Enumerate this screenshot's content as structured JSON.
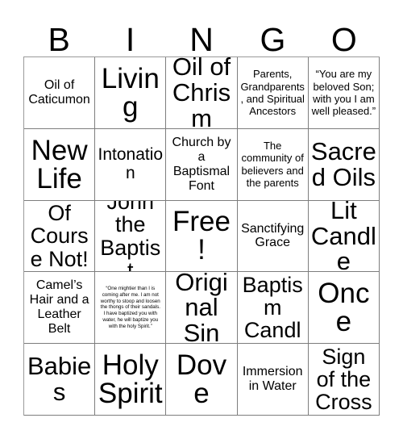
{
  "header": {
    "letters": [
      "B",
      "I",
      "N",
      "G",
      "O"
    ]
  },
  "grid": {
    "rows": 5,
    "columns": 5,
    "cells": [
      {
        "text": "Oil of Caticumon",
        "size": "sm"
      },
      {
        "text": "Living",
        "size": "xxl"
      },
      {
        "text": "Oil of Chrism",
        "size": "xl"
      },
      {
        "text": "Parents, Grandparents, and Spiritual Ancestors",
        "size": "xs"
      },
      {
        "text": "“You are my beloved Son; with you I am well pleased.”",
        "size": "xs"
      },
      {
        "text": "New Life",
        "size": "xxl"
      },
      {
        "text": "Intonation",
        "size": "md"
      },
      {
        "text": "Church by a Baptismal Font",
        "size": "sm"
      },
      {
        "text": "The community of believers and the parents",
        "size": "xs"
      },
      {
        "text": "Sacred Oils",
        "size": "xl"
      },
      {
        "text": "Of Course Not!",
        "size": "lg"
      },
      {
        "text": "John the Baptist",
        "size": "lg"
      },
      {
        "text": "Free!",
        "size": "xxl"
      },
      {
        "text": "Sanctifying Grace",
        "size": "sm"
      },
      {
        "text": "Lit Candle",
        "size": "xl"
      },
      {
        "text": "Camel’s Hair and a Leather Belt",
        "size": "sm"
      },
      {
        "text": "“One mightier than I is coming after me. I am not worthy to stoop and loosen the thongs of their sandals. I have baptized you with water, he will baptize you with the holy Spirit.”",
        "size": "tiny"
      },
      {
        "text": "Original Sin",
        "size": "xl"
      },
      {
        "text": "A Baptism Candle",
        "size": "lg"
      },
      {
        "text": "Once",
        "size": "xxl"
      },
      {
        "text": "Babies",
        "size": "xl"
      },
      {
        "text": "Holy Spirit",
        "size": "xxl"
      },
      {
        "text": "Dove",
        "size": "xxl"
      },
      {
        "text": "Immersion in Water",
        "size": "sm"
      },
      {
        "text": "Sign of the Cross",
        "size": "lg"
      }
    ]
  },
  "colors": {
    "background": "#ffffff",
    "text": "#000000",
    "border": "#7d7d7d"
  }
}
